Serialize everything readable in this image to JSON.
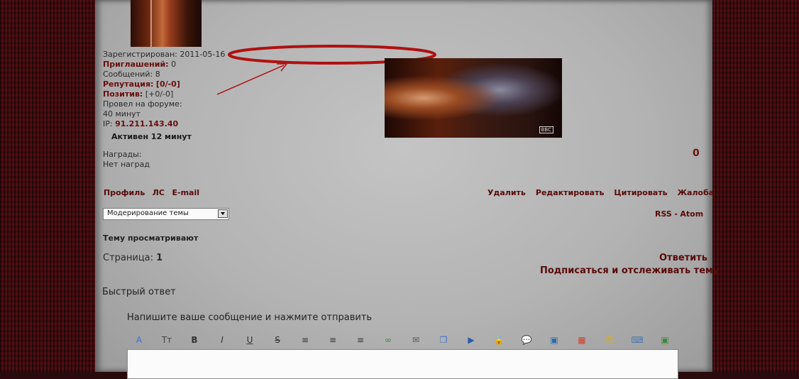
{
  "profile": {
    "registered_label": "Зарегистрирован:",
    "registered_value": "2011-05-16",
    "invites_label": "Приглашений:",
    "invites_value": "0",
    "posts_label": "Сообщений:",
    "posts_value": "8",
    "reputation_label": "Репутация:",
    "reputation_value": "[0/-0]",
    "positive_label": "Позитив:",
    "positive_value": "[+0/-0]",
    "time_label": "Провел на форуме:",
    "time_value": "40 минут",
    "ip_label": "IP:",
    "ip_value": "91.211.143.40",
    "active": "Активен 12 минут",
    "awards_label": "Награды:",
    "awards_value": "Нет наград"
  },
  "post": {
    "counter": "0",
    "user_links": [
      "Профиль",
      "ЛС",
      "E-mail"
    ],
    "actions": [
      "Удалить",
      "Редактировать",
      "Цитировать",
      "Жалоба"
    ],
    "photo_watermark": "BBC"
  },
  "topic": {
    "moderation_select": "Модерирование темы",
    "rss": "RSS",
    "rss_sep": "-",
    "atom": "Atom",
    "viewing": "Тему просматривают",
    "page_label": "Страница:",
    "page_value": "1",
    "reply": "Ответить",
    "subscribe": "Подписаться и отслеживать тему"
  },
  "quick_reply": {
    "title": "Быстрый ответ",
    "hint": "Напишите ваше сообщение и нажмите отправить",
    "toolbar": [
      {
        "icon": "font-color-icon",
        "glyph": "A",
        "color": "#3a6fd0"
      },
      {
        "icon": "font-size-icon",
        "glyph": "Tт",
        "color": "#444444"
      },
      {
        "icon": "bold-icon",
        "glyph": "B",
        "color": "#333333"
      },
      {
        "icon": "italic-icon",
        "glyph": "I",
        "color": "#333333"
      },
      {
        "icon": "underline-icon",
        "glyph": "U",
        "color": "#333333"
      },
      {
        "icon": "strikethrough-icon",
        "glyph": "S",
        "color": "#333333"
      },
      {
        "icon": "align-left-icon",
        "glyph": "≡",
        "color": "#333333"
      },
      {
        "icon": "align-center-icon",
        "glyph": "≡",
        "color": "#333333"
      },
      {
        "icon": "align-right-icon",
        "glyph": "≡",
        "color": "#333333"
      },
      {
        "icon": "link-icon",
        "glyph": "∞",
        "color": "#3a8a3a"
      },
      {
        "icon": "email-icon",
        "glyph": "✉",
        "color": "#555555"
      },
      {
        "icon": "quote-icon",
        "glyph": "❐",
        "color": "#3a6fd0"
      },
      {
        "icon": "video-icon",
        "glyph": "▶",
        "color": "#2a5ab0"
      },
      {
        "icon": "lock-icon",
        "glyph": "🔒",
        "color": "#c8a030"
      },
      {
        "icon": "comment-icon",
        "glyph": "💬",
        "color": "#3a6fd0"
      },
      {
        "icon": "image-icon",
        "glyph": "▣",
        "color": "#2a6ab0"
      },
      {
        "icon": "color-palette-icon",
        "glyph": "▦",
        "color": "#d04030"
      },
      {
        "icon": "smiley-icon",
        "glyph": "☺",
        "color": "#d8b020"
      },
      {
        "icon": "keyboard-icon",
        "glyph": "⌨",
        "color": "#4a7ab0"
      },
      {
        "icon": "insert-image-icon",
        "glyph": "▣",
        "color": "#3a8a3a"
      }
    ]
  },
  "annotation_color": "#b01010"
}
